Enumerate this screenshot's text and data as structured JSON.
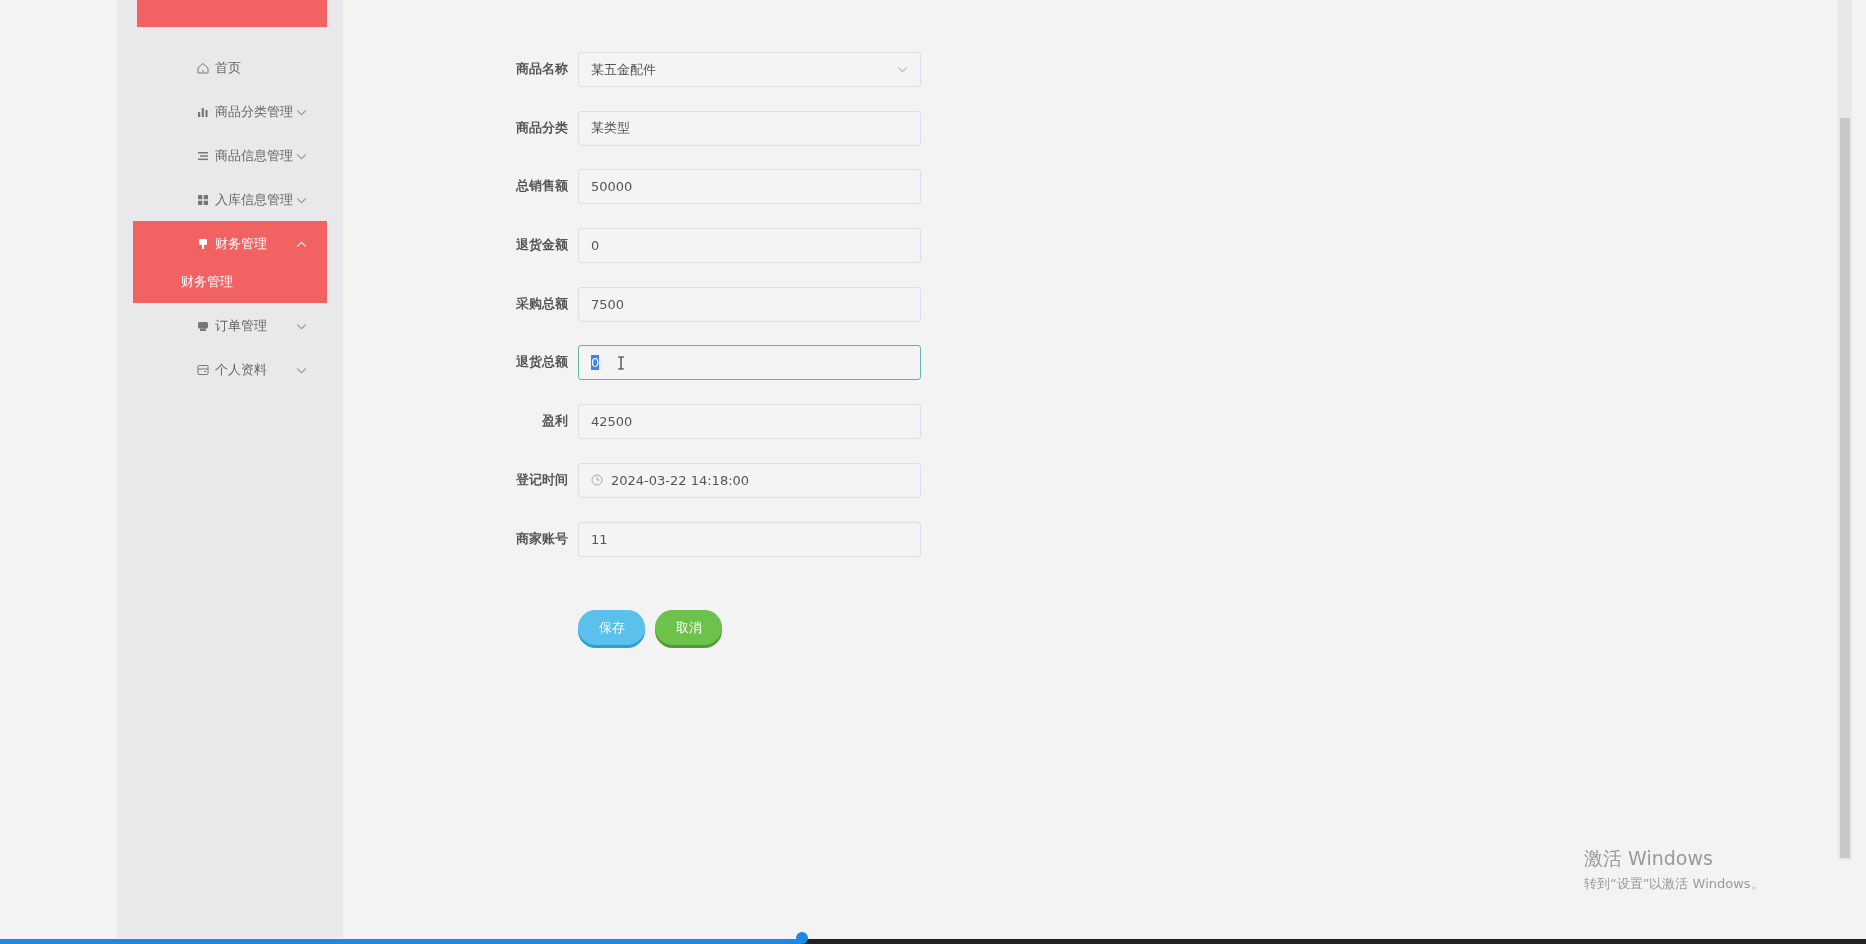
{
  "sidebar": {
    "items": [
      {
        "label": "首页",
        "selected": false
      },
      {
        "label": "商品分类管理",
        "expanded": false,
        "selected": false
      },
      {
        "label": "商品信息管理",
        "expanded": false,
        "selected": false
      },
      {
        "label": "入库信息管理",
        "expanded": false,
        "selected": false
      },
      {
        "label": "财务管理",
        "expanded": true,
        "selected": true,
        "children": [
          {
            "label": "财务管理"
          }
        ]
      },
      {
        "label": "订单管理",
        "expanded": false,
        "selected": false
      },
      {
        "label": "个人资料",
        "expanded": false,
        "selected": false
      }
    ]
  },
  "form": {
    "fields": [
      {
        "label": "商品名称",
        "kind": "select",
        "value": "某五金配件",
        "focused": false
      },
      {
        "label": "商品分类",
        "kind": "text",
        "value": "某类型",
        "focused": false
      },
      {
        "label": "总销售额",
        "kind": "text",
        "value": "50000",
        "focused": false
      },
      {
        "label": "退货金额",
        "kind": "text",
        "value": "0",
        "focused": false
      },
      {
        "label": "采购总额",
        "kind": "text",
        "value": "7500",
        "focused": false
      },
      {
        "label": "退货总额",
        "kind": "text",
        "value": "0",
        "focused": true
      },
      {
        "label": "盈利",
        "kind": "text",
        "value": "42500",
        "focused": false
      },
      {
        "label": "登记时间",
        "kind": "datetime",
        "value": "2024-03-22 14:18:00",
        "focused": false
      },
      {
        "label": "商家账号",
        "kind": "text",
        "value": "11",
        "focused": false
      }
    ],
    "buttons": [
      {
        "label": "保存",
        "kind": "save"
      },
      {
        "label": "取消",
        "kind": "cancel"
      }
    ]
  },
  "activation_notice": {
    "title": "激活 Windows",
    "subtitle": "转到“设置”以激活 Windows。"
  },
  "player": {
    "level": 0.43
  }
}
